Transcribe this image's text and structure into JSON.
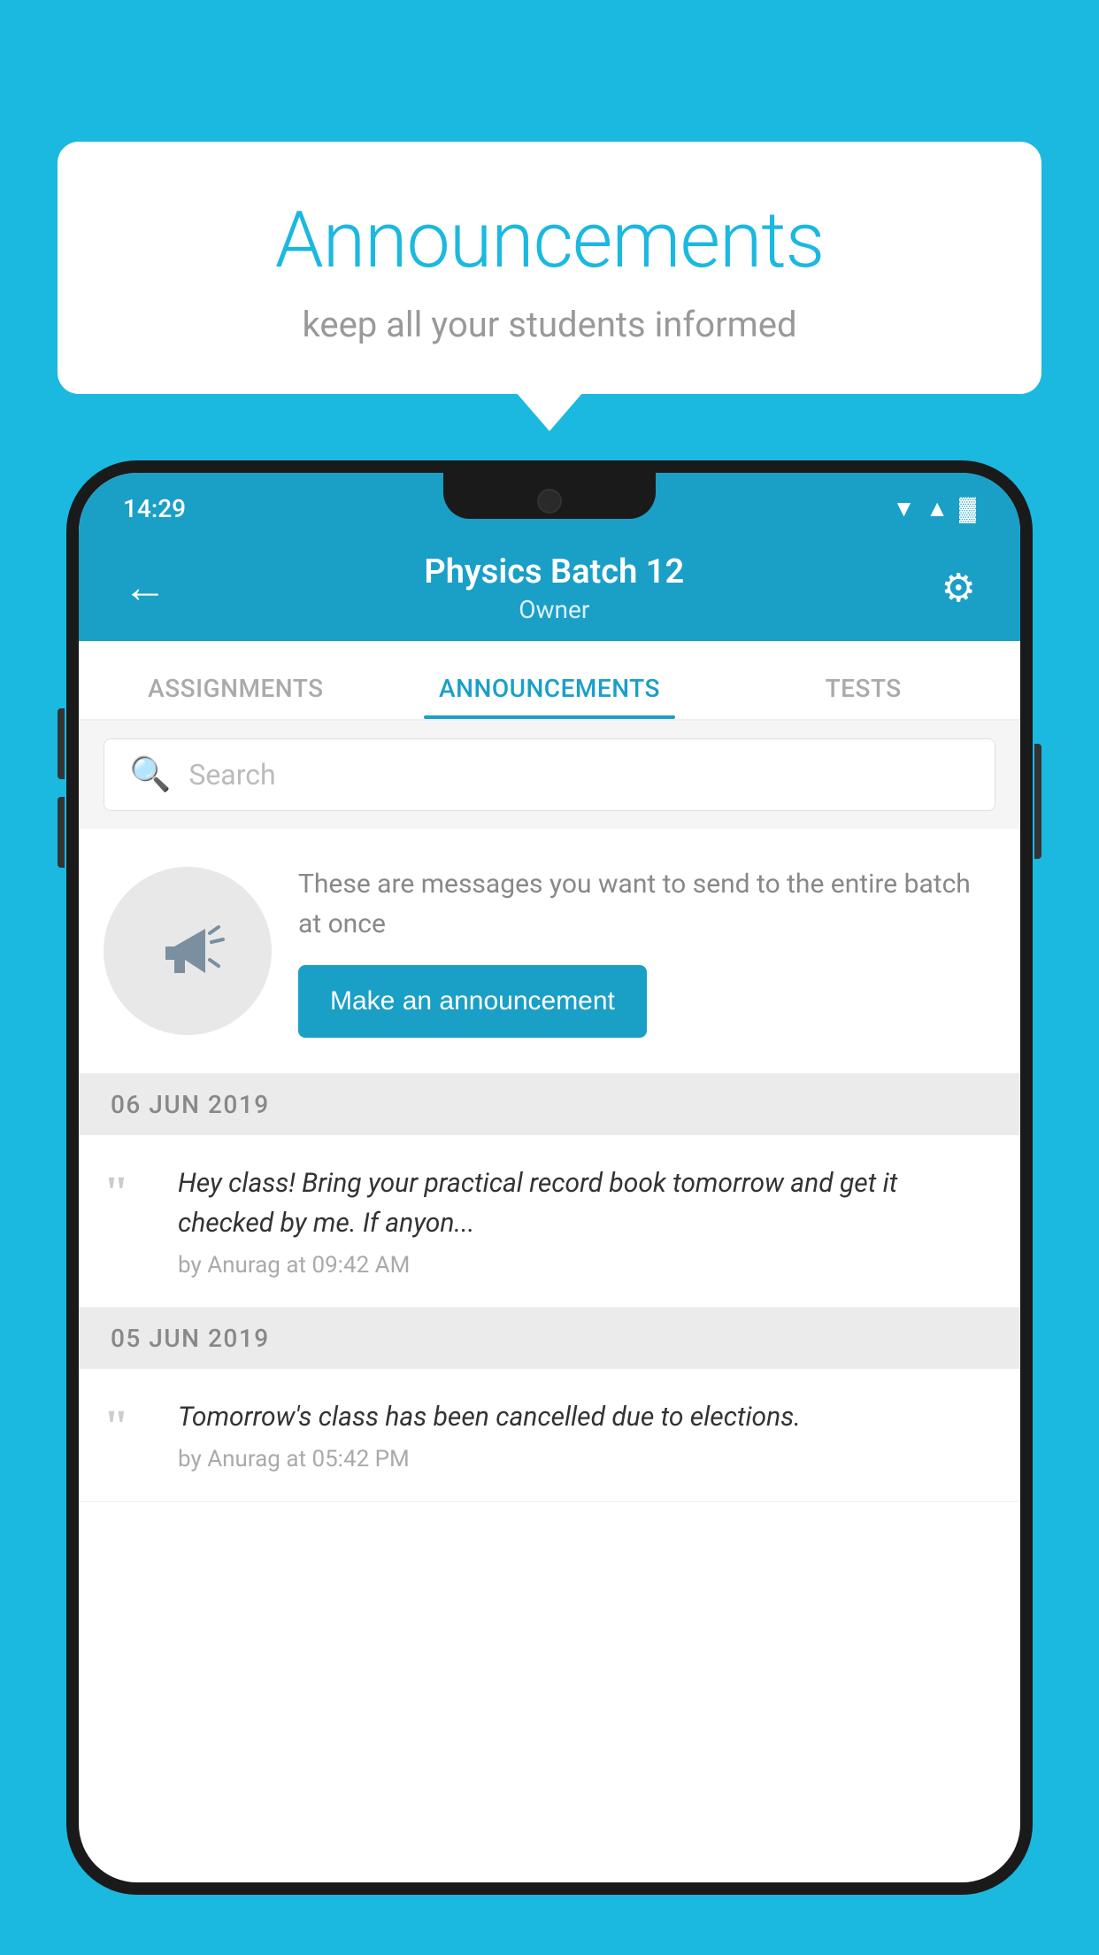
{
  "background_color": "#1bb8e0",
  "speech_bubble": {
    "title": "Announcements",
    "subtitle": "keep all your students informed"
  },
  "status_bar": {
    "time": "14:29",
    "wifi": "▲",
    "signal": "▲",
    "battery": "▓"
  },
  "app_bar": {
    "back_label": "←",
    "title": "Physics Batch 12",
    "subtitle": "Owner",
    "settings_label": "⚙"
  },
  "tabs": [
    {
      "label": "ASSIGNMENTS",
      "active": false
    },
    {
      "label": "ANNOUNCEMENTS",
      "active": true
    },
    {
      "label": "TESTS",
      "active": false
    }
  ],
  "search": {
    "placeholder": "Search"
  },
  "announcement_cta": {
    "description": "These are messages you want to send to the entire batch at once",
    "button_label": "Make an announcement"
  },
  "announcements": [
    {
      "date": "06  JUN  2019",
      "text": "Hey class! Bring your practical record book tomorrow and get it checked by me. If anyon...",
      "meta": "by Anurag at 09:42 AM"
    },
    {
      "date": "05  JUN  2019",
      "text": "Tomorrow's class has been cancelled due to elections.",
      "meta": "by Anurag at 05:42 PM"
    }
  ]
}
